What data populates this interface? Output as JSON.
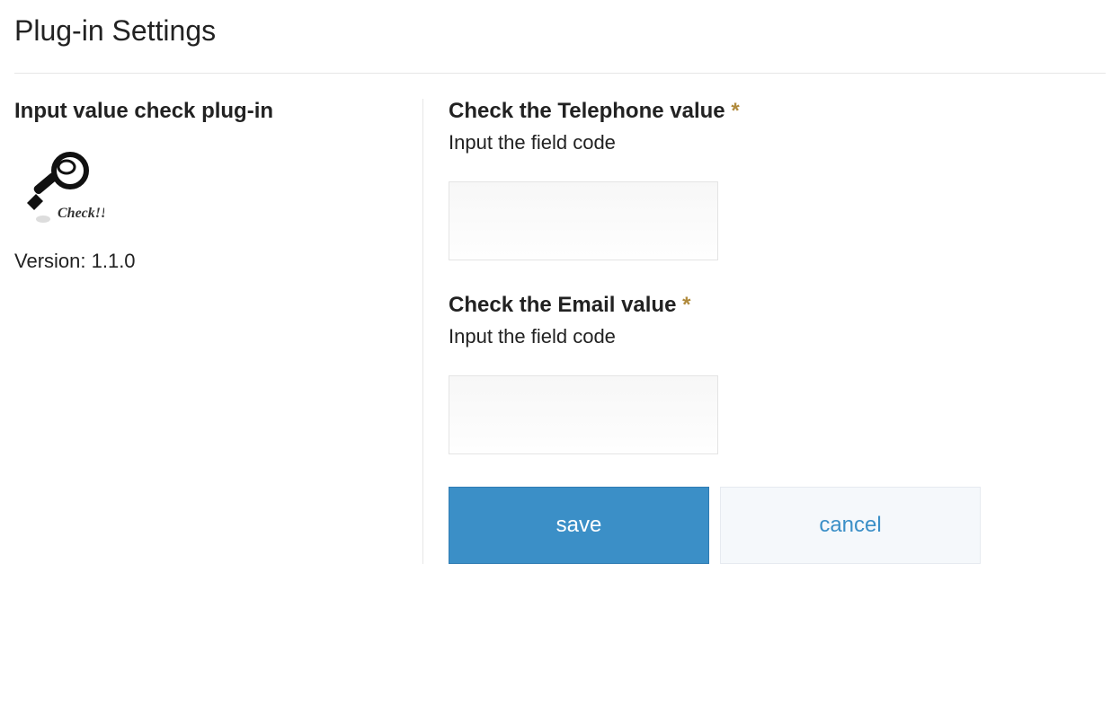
{
  "header": {
    "title": "Plug-in Settings"
  },
  "sidebar": {
    "plugin_name": "Input value check plug-in",
    "icon_caption": "Check!!",
    "version_text": "Version: 1.1.0"
  },
  "form": {
    "telephone": {
      "label": "Check the Telephone value ",
      "required_mark": "*",
      "hint": "Input the field code",
      "value": ""
    },
    "email": {
      "label": "Check the Email value ",
      "required_mark": "*",
      "hint": "Input the field code",
      "value": ""
    },
    "buttons": {
      "save": "save",
      "cancel": "cancel"
    }
  }
}
